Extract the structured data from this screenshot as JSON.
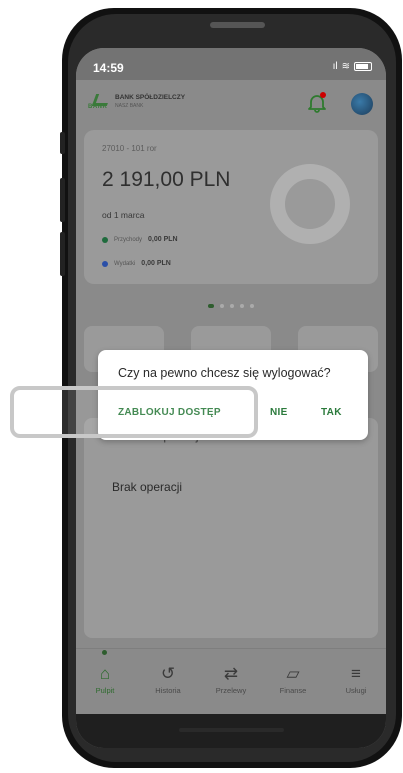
{
  "status_bar": {
    "time": "14:59",
    "signal": "ıl",
    "wifi": "≋"
  },
  "header": {
    "bank_name": "BANK SPÓŁDZIELCZY",
    "bank_subname": "NASZ BANK",
    "logo_text": "BANK"
  },
  "account": {
    "number": "27010 - 101 ror",
    "balance": "2 191,00 PLN",
    "period": "od 1 marca",
    "income_label": "Przychody",
    "income_value": "0,00 PLN",
    "expense_label": "Wydatki",
    "expense_value": "0,00 PLN"
  },
  "operations": {
    "title": "Ostatnie operacje",
    "empty_text": "Brak operacji"
  },
  "tabs": [
    {
      "label": "Pulpit",
      "icon": "⌂"
    },
    {
      "label": "Historia",
      "icon": "↺"
    },
    {
      "label": "Przelewy",
      "icon": "⇄"
    },
    {
      "label": "Finanse",
      "icon": "▱"
    },
    {
      "label": "Usługi",
      "icon": "≡"
    }
  ],
  "dialog": {
    "question": "Czy na pewno chcesz się wylogować?",
    "block_label": "ZABLOKUJ DOSTĘP",
    "no_label": "NIE",
    "yes_label": "TAK"
  },
  "colors": {
    "accent": "#2b7a3c",
    "income_dot": "#1f6b3d",
    "expense_dot": "#2a4fa8"
  }
}
